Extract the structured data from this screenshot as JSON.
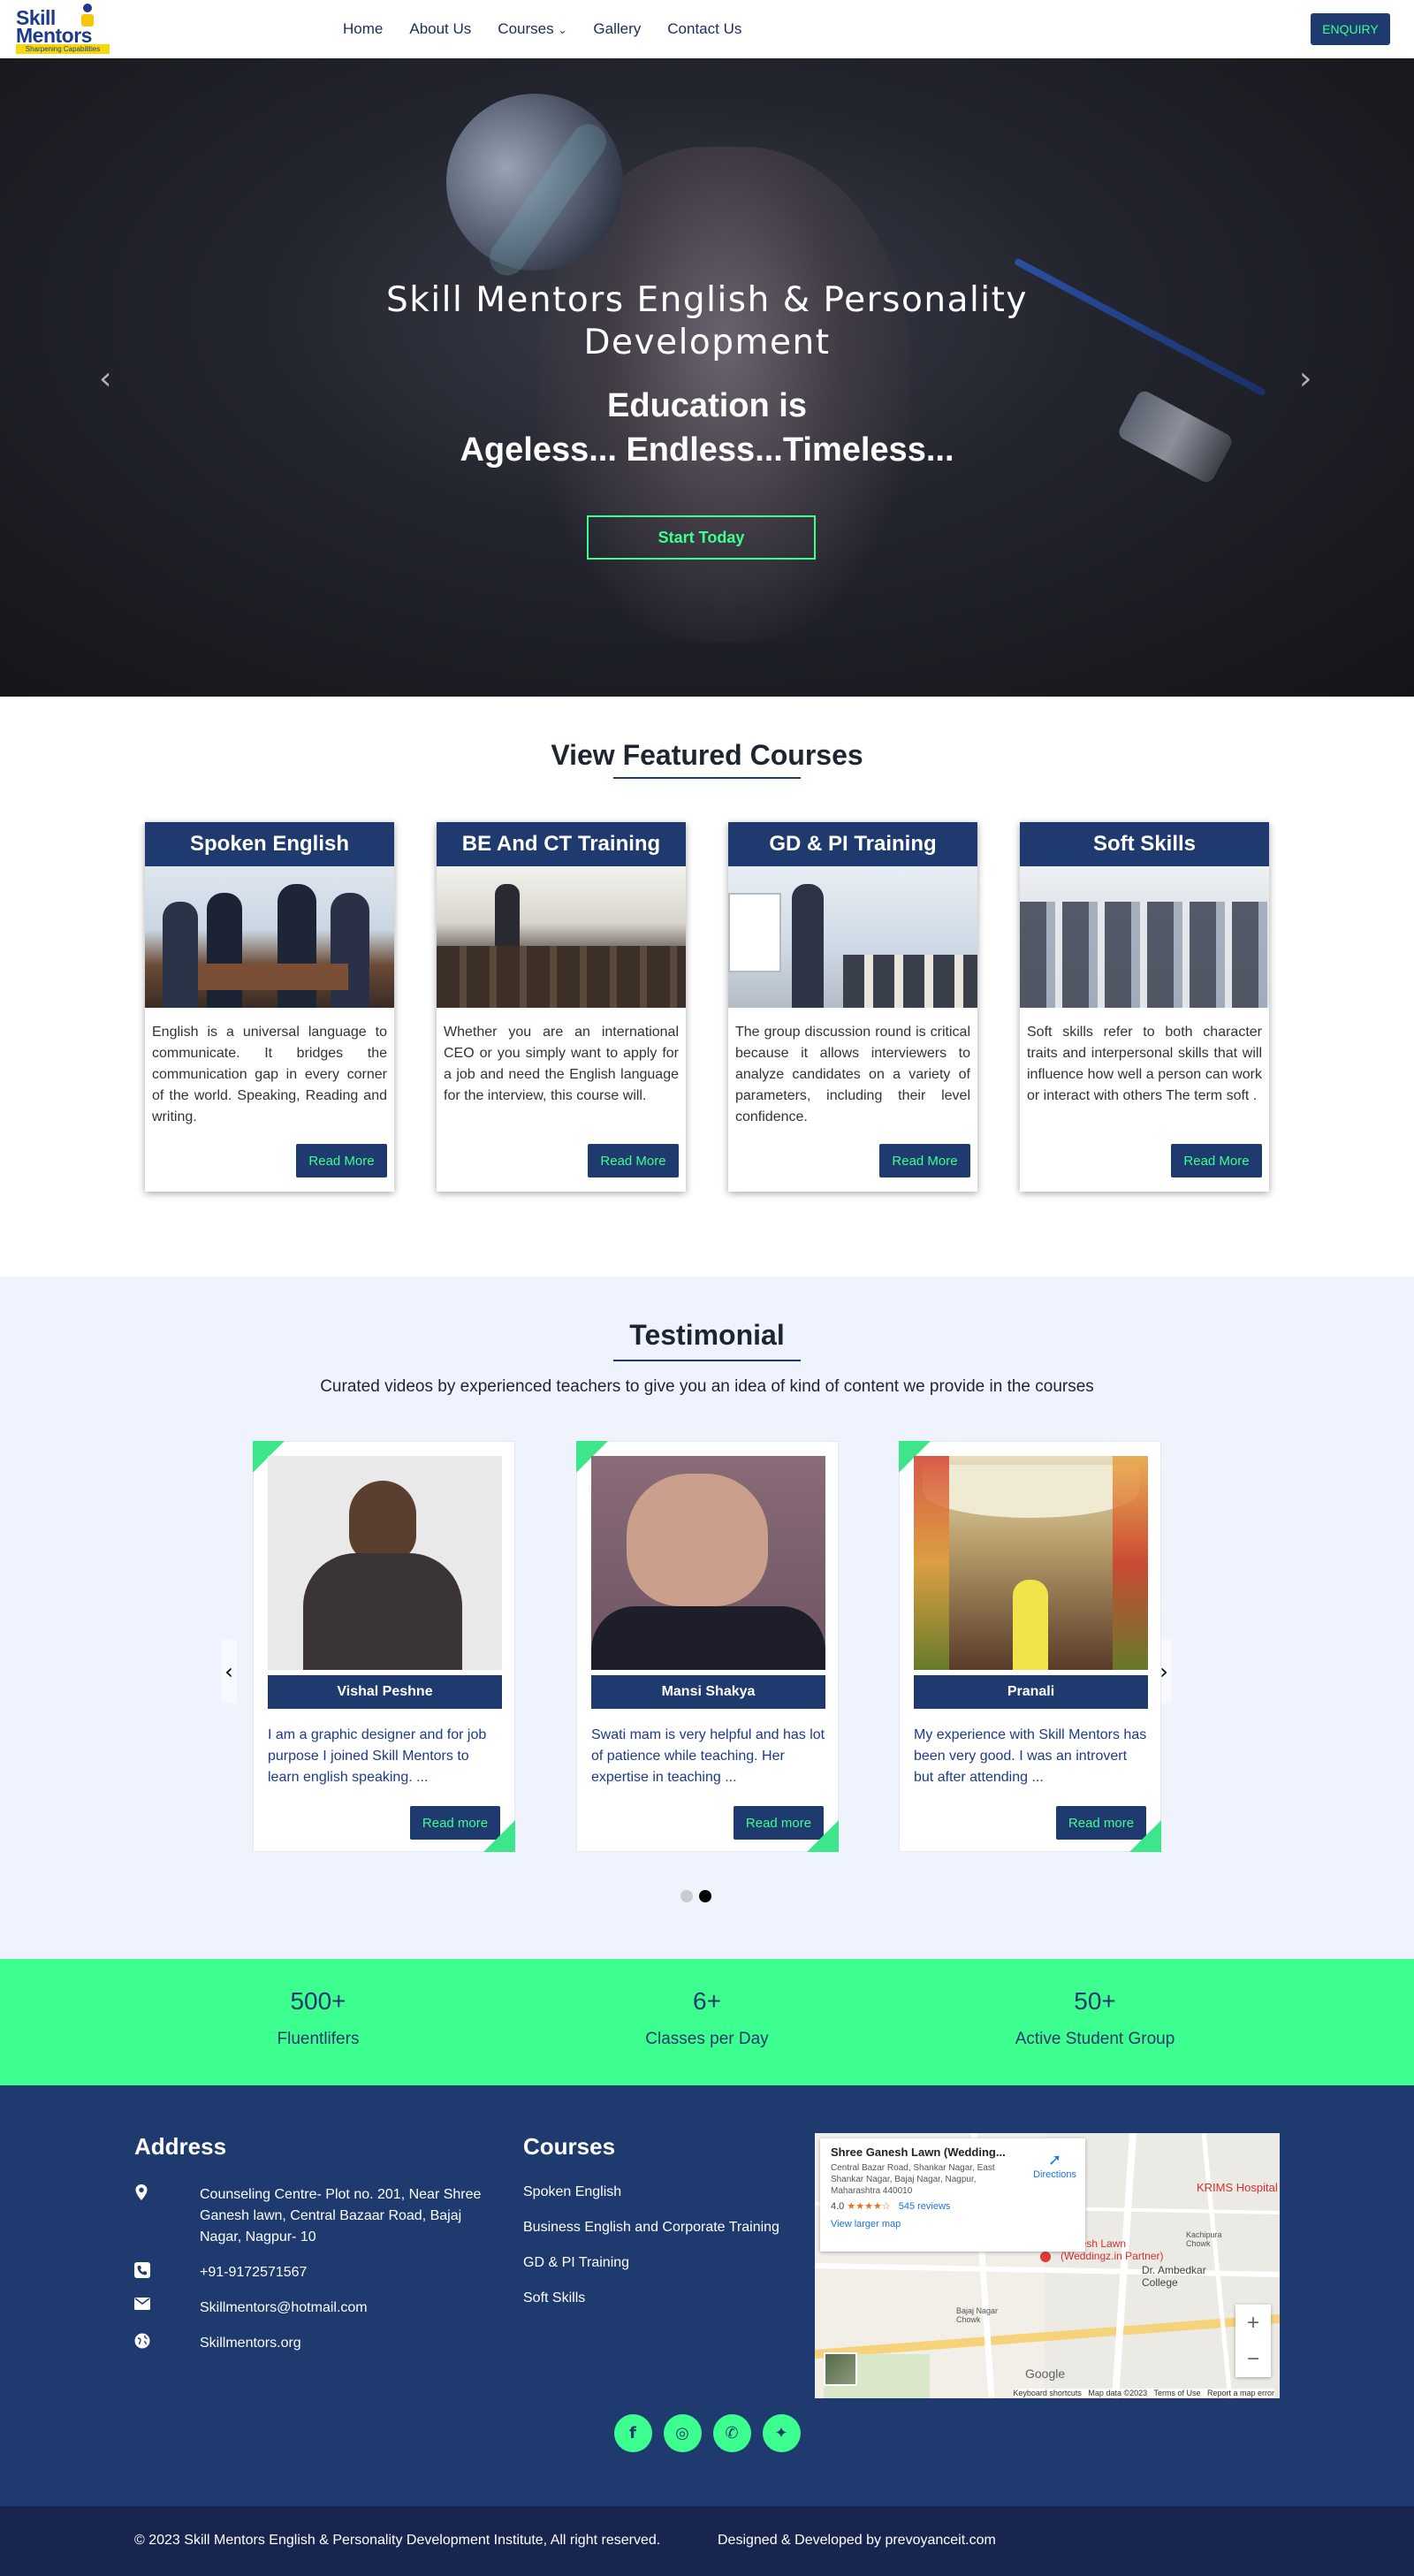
{
  "brand": {
    "logo_line1": "Skill",
    "logo_line2": "Mentors",
    "logo_tagline": "Sharpening Capabilities"
  },
  "nav": {
    "items": [
      "Home",
      "About Us",
      "Courses",
      "Gallery",
      "Contact Us"
    ],
    "courses_caret": "⌄",
    "enquiry_label": "ENQUIRY"
  },
  "hero": {
    "title": "Skill Mentors English & Personality Development",
    "subtitle_line1": "Education is",
    "subtitle_line2": "Ageless... Endless...Timeless...",
    "cta_label": "Start Today",
    "prev_arrow": "‹",
    "next_arrow": "›"
  },
  "featured": {
    "title": "View Featured Courses",
    "courses": [
      {
        "title": "Spoken English",
        "description": "English is a universal language to communicate. It bridges the communication gap in every corner of the world. Speaking, Reading and writing.",
        "button": "Read More"
      },
      {
        "title": "BE And CT Training",
        "description": "Whether you are an international CEO or you simply want to apply for a job and need the English language for the interview, this course will.",
        "button": "Read More"
      },
      {
        "title": "GD & PI Training",
        "description": "The group discussion round is critical because it allows interviewers to analyze candidates on a variety of parameters, including their level confidence.",
        "button": "Read More"
      },
      {
        "title": "Soft Skills",
        "description": "Soft skills refer to both character traits and interpersonal skills that will influence how well a person can work or interact with others The term soft .",
        "button": "Read More"
      }
    ]
  },
  "testimonial": {
    "title": "Testimonial",
    "subtitle": "Curated videos by experienced teachers to give you an idea of kind of content we provide in the courses",
    "prev_arrow": "‹",
    "next_arrow": "›",
    "items": [
      {
        "name": "Vishal Peshne",
        "text": "I am a graphic designer and for job purpose I joined Skill Mentors to learn english speaking. ...",
        "button": "Read more"
      },
      {
        "name": "Mansi Shakya",
        "text": "Swati mam is very helpful and has lot of patience while teaching. Her expertise in teaching ...",
        "button": "Read more"
      },
      {
        "name": "Pranali",
        "text": "My experience with Skill Mentors has been very good. I was an introvert but after attending ...",
        "button": "Read more"
      }
    ],
    "active_page": 2,
    "page_count": 2
  },
  "stats": [
    {
      "value": "500+",
      "label": "Fluentlifers"
    },
    {
      "value": "6+",
      "label": "Classes per Day"
    },
    {
      "value": "50+",
      "label": "Active Student Group"
    }
  ],
  "footer": {
    "address_heading": "Address",
    "address": "Counseling Centre- Plot no. 201, Near Shree Ganesh lawn, Central Bazaar Road, Bajaj Nagar, Nagpur- 10",
    "phone": "+91-9172571567",
    "email": "Skillmentors@hotmail.com",
    "website": "Skillmentors.org",
    "courses_heading": "Courses",
    "course_links": [
      "Spoken English",
      "Business English and Corporate Training",
      "GD & PI Training",
      "Soft Skills"
    ],
    "map": {
      "place_name": "Shree Ganesh Lawn (Wedding...",
      "place_address": "Central Bazar Road, Shankar Nagar, East Shankar Nagar, Bajaj Nagar, Nagpur, Maharashtra 440010",
      "rating": "4.0",
      "stars": "★★★★☆",
      "reviews": "545 reviews",
      "directions": "Directions",
      "larger_map": "View larger map",
      "label_krims": "KRIMS Hospital",
      "label_lawn": "Ganesh Lawn (Weddingz.in Partner)",
      "label_ambedkar": "Dr. Ambedkar College",
      "label_kachipura": "Kachipura Chowk",
      "label_bajaj": "Bajaj Nagar Chowk",
      "label_google": "Google",
      "attribution": "Keyboard shortcuts   Map data ©2023   Terms of Use   Report a map error",
      "zoom_in": "+",
      "zoom_out": "−"
    },
    "socials": [
      {
        "icon": "facebook-icon",
        "glyph": "f"
      },
      {
        "icon": "instagram-icon",
        "glyph": "◎"
      },
      {
        "icon": "whatsapp-icon",
        "glyph": "✆"
      },
      {
        "icon": "twitter-icon",
        "glyph": "✦"
      }
    ],
    "copyright": "© 2023 Skill Mentors English & Personality Development Institute, All right reserved.",
    "designed_by": "Designed & Developed by prevoyanceit.com"
  },
  "colors": {
    "primary": "#1e3a6e",
    "accent": "#3dff8f",
    "testimonial_bg": "#eef3fd"
  }
}
